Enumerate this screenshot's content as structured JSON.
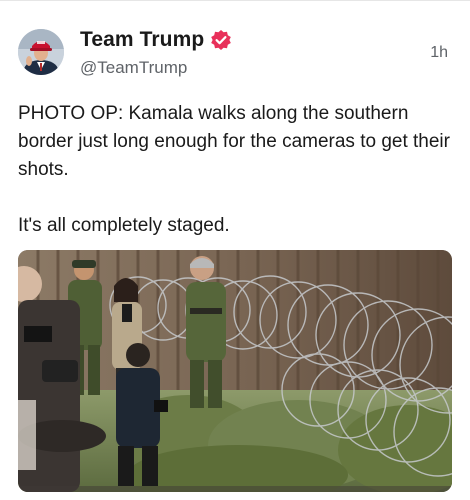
{
  "post": {
    "author": {
      "display_name": "Team Trump",
      "handle": "@TeamTrump",
      "verified_badge_icon": "verified-badge-icon",
      "badge_color": "#e8305a"
    },
    "timestamp": "1h",
    "text_lines": [
      "PHOTO OP: Kamala walks along the southern border just long enough for the cameras to get their shots.",
      "It's all completely staged."
    ],
    "media": {
      "type": "photo"
    }
  }
}
